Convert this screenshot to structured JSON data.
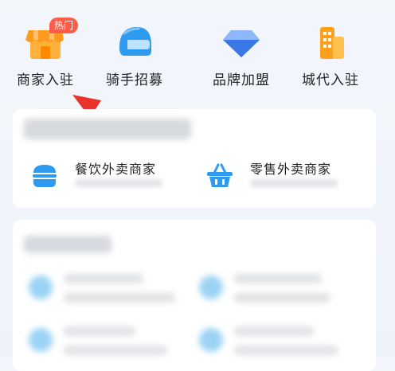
{
  "top_grid": {
    "hot_badge": "热门",
    "items": [
      {
        "label": "商家入驻",
        "icon": "shop-icon"
      },
      {
        "label": "骑手招募",
        "icon": "helmet-icon"
      },
      {
        "label": "品牌加盟",
        "icon": "diamond-icon"
      },
      {
        "label": "城代入驻",
        "icon": "building-icon"
      }
    ]
  },
  "merchant_types": [
    {
      "label": "餐饮外卖商家",
      "icon": "burger-icon"
    },
    {
      "label": "零售外卖商家",
      "icon": "basket-icon"
    }
  ],
  "colors": {
    "accent_orange": "#ff9f1a",
    "accent_blue": "#2f9bf0",
    "badge_red": "#ff5b4a",
    "annotation_red": "#e8322a"
  }
}
